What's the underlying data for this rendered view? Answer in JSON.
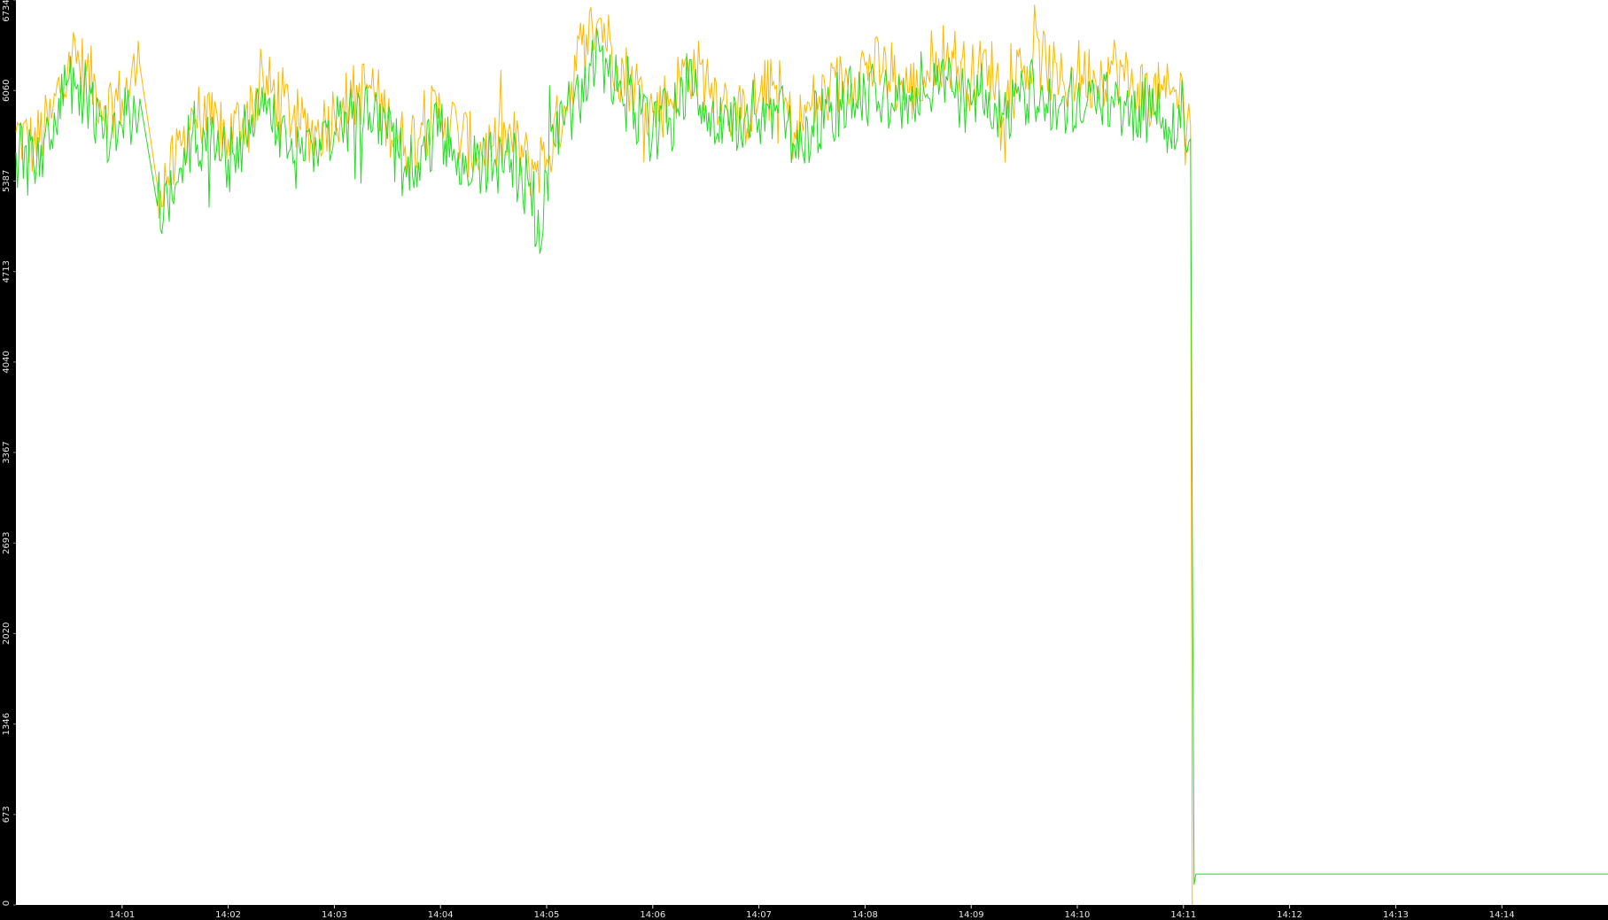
{
  "chart_data": {
    "type": "line",
    "title": "",
    "xlabel": "",
    "ylabel": "",
    "background": "#ffffff",
    "axis_color": "#000000",
    "ylim": [
      0,
      6734
    ],
    "y_ticks": [
      "0",
      "673",
      "1346",
      "2020",
      "2693",
      "3367",
      "4040",
      "4713",
      "5387",
      "6060",
      "6734"
    ],
    "x_range": [
      "14:00:00",
      "14:15:00"
    ],
    "x_ticks": [
      "14:01",
      "14:02",
      "14:03",
      "14:04",
      "14:05",
      "14:06",
      "14:07",
      "14:08",
      "14:09",
      "14:10",
      "14:11",
      "14:12",
      "14:13",
      "14:14"
    ],
    "series": [
      {
        "color": "#ffb700",
        "x": [
          "14:00:00",
          "14:00:10",
          "14:00:20",
          "14:00:30",
          "14:00:40",
          "14:00:50",
          "14:01:00",
          "14:01:10",
          "14:01:20",
          "14:01:30",
          "14:01:40",
          "14:01:50",
          "14:02:00",
          "14:02:10",
          "14:02:20",
          "14:02:30",
          "14:02:40",
          "14:02:50",
          "14:03:00",
          "14:03:10",
          "14:03:20",
          "14:03:30",
          "14:03:40",
          "14:03:50",
          "14:04:00",
          "14:04:10",
          "14:04:20",
          "14:04:30",
          "14:04:40",
          "14:04:50",
          "14:05:00",
          "14:05:10",
          "14:05:20",
          "14:05:30",
          "14:05:40",
          "14:05:50",
          "14:06:00",
          "14:06:10",
          "14:06:20",
          "14:06:30",
          "14:06:40",
          "14:06:50",
          "14:07:00",
          "14:07:10",
          "14:07:20",
          "14:07:30",
          "14:07:40",
          "14:07:50",
          "14:08:00",
          "14:08:10",
          "14:08:20",
          "14:08:30",
          "14:08:40",
          "14:08:50",
          "14:09:00",
          "14:09:10",
          "14:09:20",
          "14:09:30",
          "14:09:40",
          "14:09:50",
          "14:10:00",
          "14:10:10",
          "14:10:20",
          "14:10:30",
          "14:10:40",
          "14:10:50",
          "14:11:00",
          "14:11:04",
          "14:11:05"
        ],
        "y": [
          5750,
          5650,
          5850,
          6350,
          6200,
          5950,
          6000,
          6250,
          5350,
          5500,
          5900,
          5800,
          5700,
          5900,
          6100,
          6000,
          5800,
          5750,
          5900,
          6000,
          6100,
          5850,
          5650,
          5800,
          5900,
          5750,
          5600,
          5650,
          5700,
          5500,
          5550,
          5950,
          6400,
          6600,
          6250,
          6100,
          5900,
          6000,
          6250,
          6150,
          6000,
          5850,
          6000,
          6100,
          5750,
          5950,
          6050,
          6150,
          6250,
          6200,
          6100,
          6050,
          6350,
          6300,
          6150,
          6250,
          6000,
          6250,
          6300,
          6100,
          6200,
          6150,
          6250,
          6100,
          6050,
          6000,
          6050,
          5800,
          0
        ]
      },
      {
        "color": "#22dd22",
        "x": [
          "14:00:00",
          "14:00:10",
          "14:00:20",
          "14:00:30",
          "14:00:40",
          "14:00:50",
          "14:01:00",
          "14:01:10",
          "14:01:20",
          "14:01:30",
          "14:01:40",
          "14:01:50",
          "14:02:00",
          "14:02:10",
          "14:02:20",
          "14:02:30",
          "14:02:40",
          "14:02:50",
          "14:03:00",
          "14:03:10",
          "14:03:20",
          "14:03:30",
          "14:03:40",
          "14:03:50",
          "14:04:00",
          "14:04:10",
          "14:04:20",
          "14:04:30",
          "14:04:40",
          "14:04:50",
          "14:04:57",
          "14:05:00",
          "14:05:10",
          "14:05:20",
          "14:05:30",
          "14:05:40",
          "14:05:50",
          "14:06:00",
          "14:06:10",
          "14:06:20",
          "14:06:30",
          "14:06:40",
          "14:06:50",
          "14:07:00",
          "14:07:10",
          "14:07:20",
          "14:07:30",
          "14:07:40",
          "14:07:50",
          "14:08:00",
          "14:08:10",
          "14:08:20",
          "14:08:30",
          "14:08:40",
          "14:08:50",
          "14:09:00",
          "14:09:10",
          "14:09:20",
          "14:09:30",
          "14:09:40",
          "14:09:50",
          "14:10:00",
          "14:10:10",
          "14:10:20",
          "14:10:30",
          "14:10:40",
          "14:10:50",
          "14:11:00",
          "14:11:04",
          "14:11:05",
          "14:11:06",
          "14:11:07",
          "14:11:08",
          "14:15:00"
        ],
        "y": [
          5600,
          5500,
          5700,
          6150,
          6000,
          5750,
          5800,
          6000,
          5200,
          5350,
          5750,
          5650,
          5550,
          5750,
          5900,
          5800,
          5650,
          5600,
          5750,
          5850,
          5900,
          5700,
          5500,
          5650,
          5750,
          5600,
          5500,
          5500,
          5550,
          5350,
          4900,
          5450,
          5800,
          6150,
          6350,
          6050,
          5900,
          5750,
          5850,
          6050,
          5950,
          5850,
          5700,
          5850,
          5950,
          5650,
          5800,
          5900,
          6000,
          6050,
          6000,
          5950,
          5900,
          6100,
          6050,
          5950,
          6050,
          5850,
          6050,
          6100,
          5950,
          6000,
          5950,
          6000,
          5900,
          5900,
          5850,
          5900,
          5700,
          2800,
          150,
          230,
          230,
          230
        ]
      }
    ]
  }
}
